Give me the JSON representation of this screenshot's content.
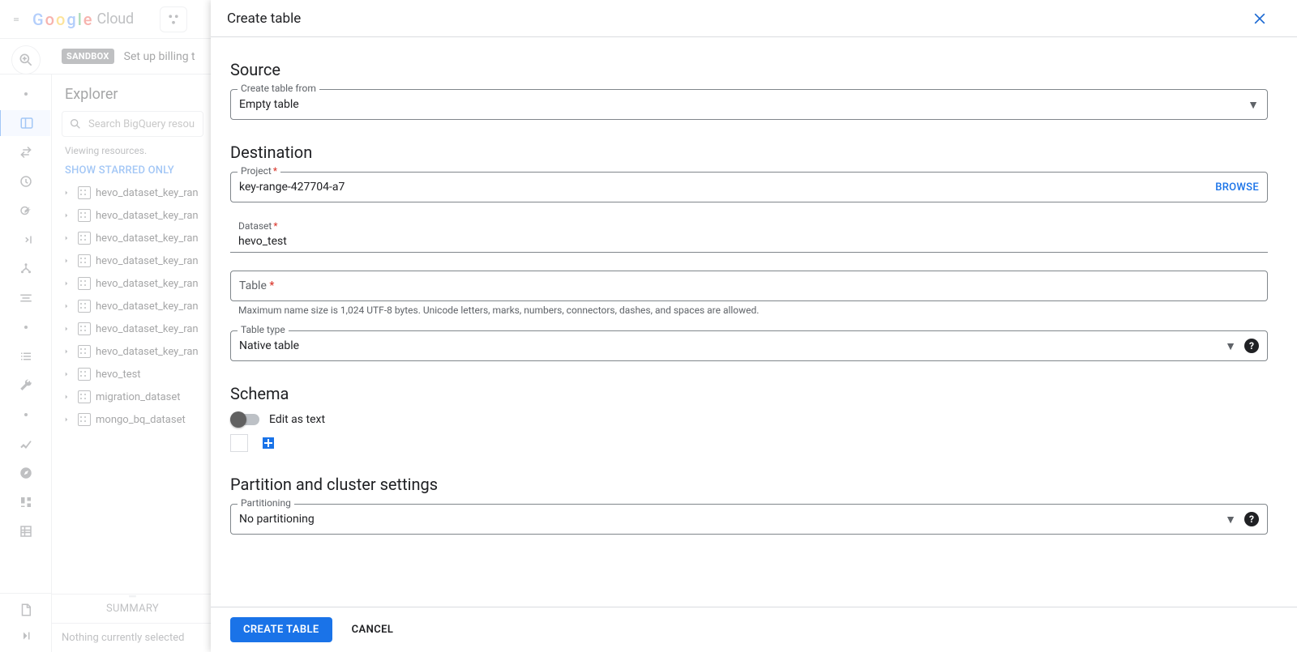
{
  "header": {
    "logo_cloud_word": "Cloud"
  },
  "billing": {
    "badge": "SANDBOX",
    "text": "Set up billing t"
  },
  "explorer": {
    "title": "Explorer",
    "search_placeholder": "Search BigQuery resource",
    "viewing": "Viewing resources.",
    "starred": "SHOW STARRED ONLY",
    "items": [
      "hevo_dataset_key_ran",
      "hevo_dataset_key_ran",
      "hevo_dataset_key_ran",
      "hevo_dataset_key_ran",
      "hevo_dataset_key_ran",
      "hevo_dataset_key_ran",
      "hevo_dataset_key_ran",
      "hevo_dataset_key_ran",
      "hevo_test",
      "migration_dataset",
      "mongo_bq_dataset"
    ],
    "summary": "SUMMARY",
    "nothing": "Nothing currently selected"
  },
  "panel": {
    "title": "Create table",
    "source": {
      "heading": "Source",
      "create_from_label": "Create table from",
      "create_from_value": "Empty table"
    },
    "destination": {
      "heading": "Destination",
      "project_label": "Project",
      "project_value": "key-range-427704-a7",
      "browse": "BROWSE",
      "dataset_label": "Dataset",
      "dataset_value": "hevo_test",
      "table_label": "Table",
      "table_helper": "Maximum name size is 1,024 UTF-8 bytes. Unicode letters, marks, numbers, connectors, dashes, and spaces are allowed.",
      "table_type_label": "Table type",
      "table_type_value": "Native table"
    },
    "schema": {
      "heading": "Schema",
      "edit_as_text": "Edit as text"
    },
    "partition": {
      "heading": "Partition and cluster settings",
      "partitioning_label": "Partitioning",
      "partitioning_value": "No partitioning"
    },
    "footer": {
      "create": "CREATE TABLE",
      "cancel": "CANCEL"
    }
  }
}
